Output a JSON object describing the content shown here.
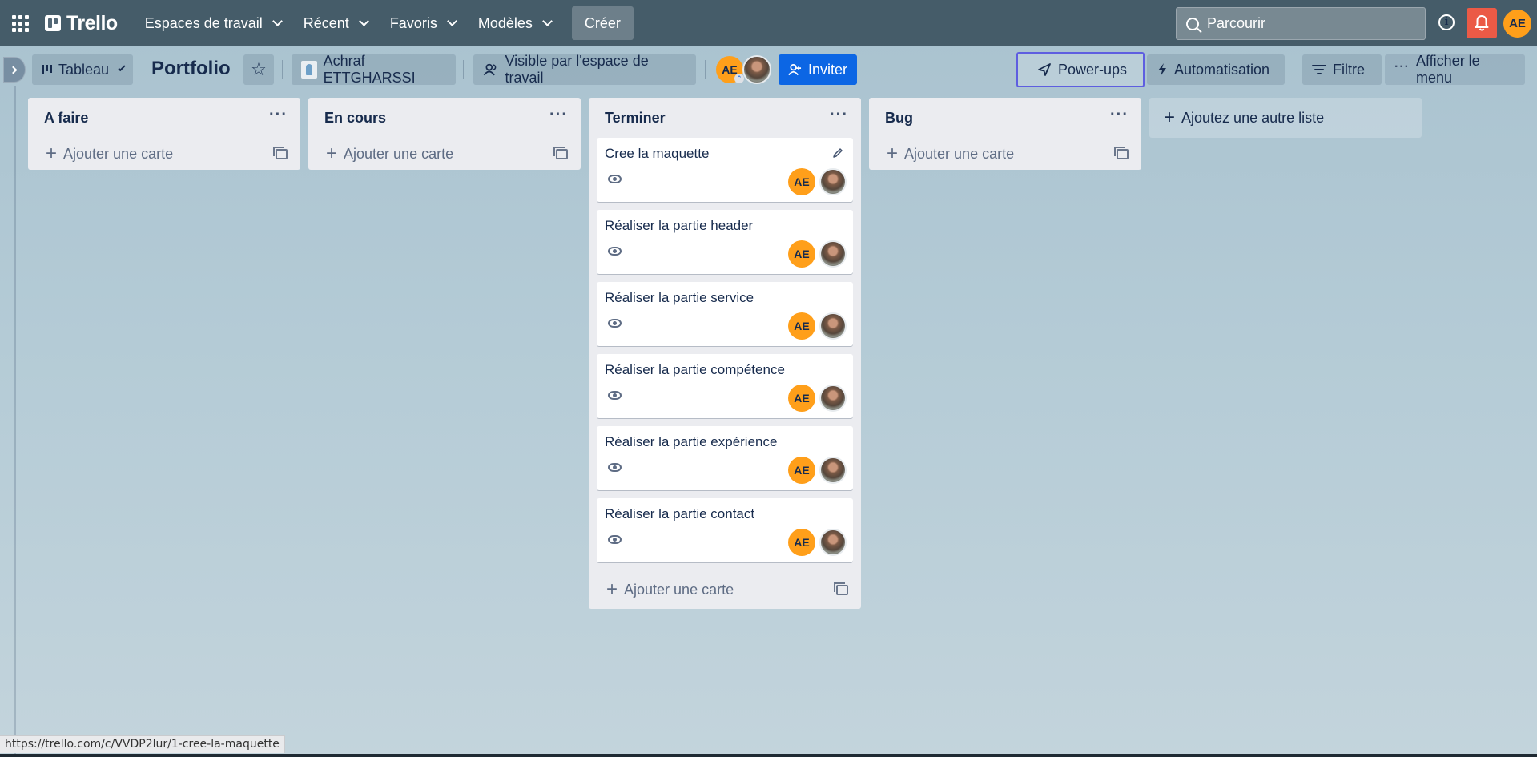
{
  "topnav": {
    "logo": "Trello",
    "items": [
      {
        "label": "Espaces de travail"
      },
      {
        "label": "Récent"
      },
      {
        "label": "Favoris"
      },
      {
        "label": "Modèles"
      }
    ],
    "create_label": "Créer",
    "search_placeholder": "Parcourir",
    "user_initials": "AE"
  },
  "board": {
    "view_label": "Tableau",
    "title": "Portfolio",
    "workspace_name": "Achraf ETTGHARSSI",
    "visibility_label": "Visible par l'espace de travail",
    "member_initials": "AE",
    "invite_label": "Inviter",
    "powerups_label": "Power-ups",
    "automation_label": "Automatisation",
    "filter_label": "Filtre",
    "menu_label": "Afficher le menu"
  },
  "lists": [
    {
      "title": "A faire",
      "add_card_label": "Ajouter une carte",
      "cards": []
    },
    {
      "title": "En cours",
      "add_card_label": "Ajouter une carte",
      "cards": []
    },
    {
      "title": "Terminer",
      "add_card_label": "Ajouter une carte",
      "cards": [
        {
          "title": "Cree la maquette",
          "initials": "AE"
        },
        {
          "title": "Réaliser la partie header",
          "initials": "AE"
        },
        {
          "title": "Réaliser la partie service",
          "initials": "AE"
        },
        {
          "title": "Réaliser la partie compétence",
          "initials": "AE"
        },
        {
          "title": "Réaliser la partie expérience",
          "initials": "AE"
        },
        {
          "title": "Réaliser la partie contact",
          "initials": "AE"
        }
      ]
    },
    {
      "title": "Bug",
      "add_card_label": "Ajouter une carte",
      "cards": []
    }
  ],
  "add_list_label": "Ajoutez une autre liste",
  "status_url": "https://trello.com/c/VVDP2lur/1-cree-la-maquette",
  "colors": {
    "nav_bg": "#293f4b",
    "accent_blue": "#0c66e4",
    "avatar_orange": "#ff9f1a",
    "notification_red": "#eb5a46",
    "powerups_border": "#5e5ee0"
  }
}
